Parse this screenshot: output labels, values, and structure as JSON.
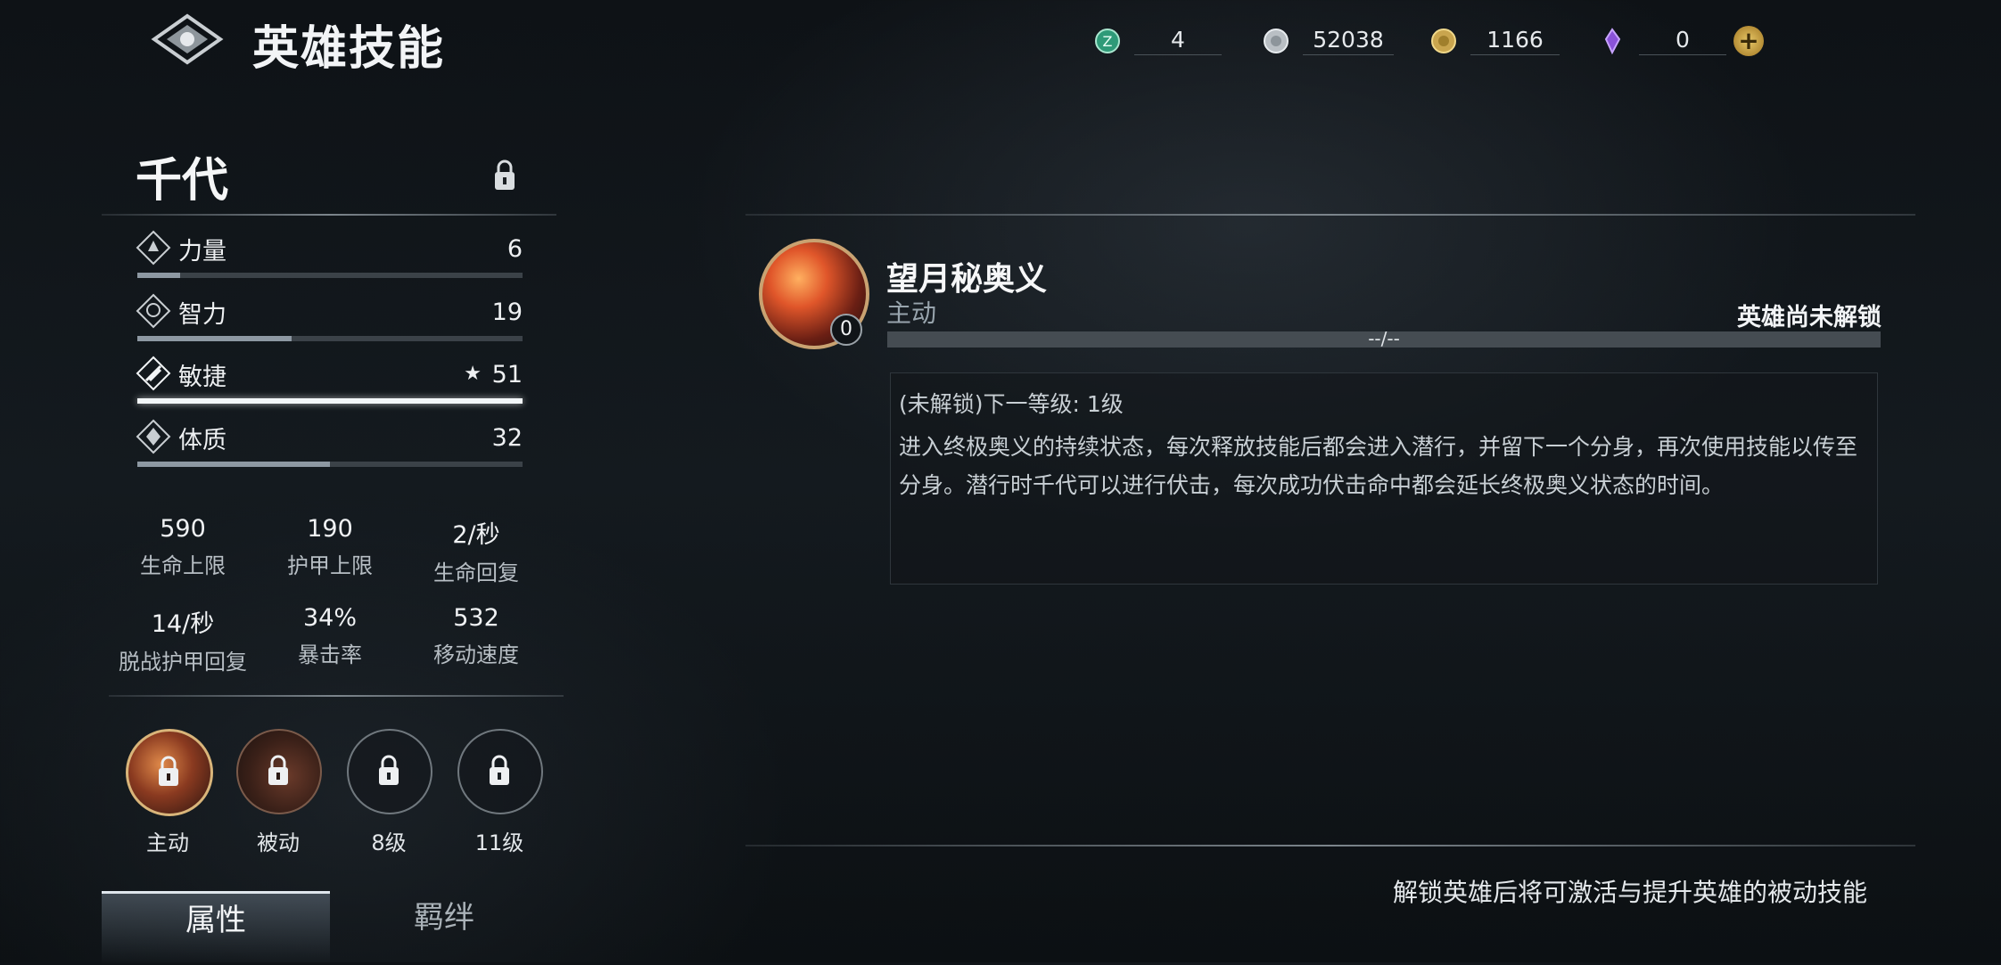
{
  "header": {
    "title": "英雄技能",
    "currencies": [
      {
        "icon": "green-token-icon",
        "value": "4"
      },
      {
        "icon": "silver-coin-icon",
        "value": "52038"
      },
      {
        "icon": "gold-coin-icon",
        "value": "1166"
      },
      {
        "icon": "purple-crystal-icon",
        "value": "0"
      }
    ],
    "plus": "+"
  },
  "hero": {
    "name": "千代",
    "stats": [
      {
        "label": "力量",
        "value": "6",
        "level": 0.11,
        "icon": "strength-icon"
      },
      {
        "label": "智力",
        "value": "19",
        "level": 0.4,
        "icon": "intelligence-icon"
      },
      {
        "label": "敏捷",
        "value": "51",
        "level": 1.0,
        "icon": "agility-icon",
        "starred": true,
        "star": "★"
      },
      {
        "label": "体质",
        "value": "32",
        "level": 0.5,
        "icon": "constitution-icon"
      }
    ],
    "attributes": [
      {
        "value": "590",
        "label": "生命上限"
      },
      {
        "value": "190",
        "label": "护甲上限"
      },
      {
        "value": "2/秒",
        "label": "生命回复"
      },
      {
        "value": "14/秒",
        "label": "脱战护甲回复"
      },
      {
        "value": "34%",
        "label": "暴击率"
      },
      {
        "value": "532",
        "label": "移动速度"
      }
    ],
    "skill_slots": [
      {
        "label": "主动"
      },
      {
        "label": "被动"
      },
      {
        "label": "8级"
      },
      {
        "label": "11级"
      }
    ],
    "tabs": [
      "属性",
      "羁绊"
    ]
  },
  "skill": {
    "name": "望月秘奥义",
    "type": "主动",
    "level": "0",
    "status": "英雄尚未解锁",
    "progress": "--/--",
    "next_level": "(未解锁)下一等级: 1级",
    "description": "进入终极奥义的持续状态，每次释放技能后都会进入潜行，并留下一个分身，再次使用技能以传至分身。潜行时千代可以进行伏击，每次成功伏击命中都会延长终极奥义状态的时间。"
  },
  "footer_note": "解锁英雄后将可激活与提升英雄的被动技能",
  "colors": {
    "accent_gold": "#d9b57a",
    "background": "#12171b"
  }
}
